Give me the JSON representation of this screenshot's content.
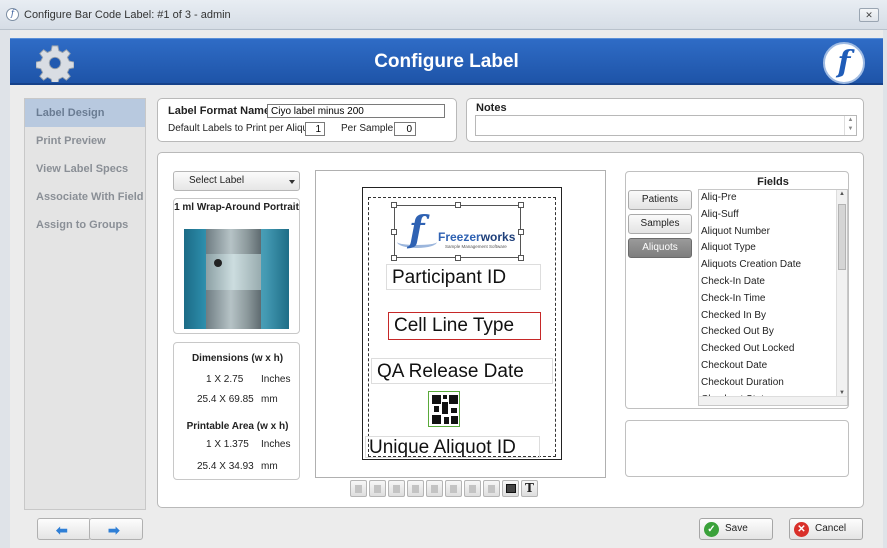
{
  "window": {
    "title": "Configure Bar Code Label: #1 of 3 - admin",
    "close_glyph": "✕"
  },
  "banner": {
    "title": "Configure Label",
    "logo_glyph": "f"
  },
  "sidebar": {
    "items": [
      {
        "label": "Label Design",
        "active": true
      },
      {
        "label": "Print Preview",
        "active": false
      },
      {
        "label": "View Label Specs",
        "active": false
      },
      {
        "label": "Associate With Field",
        "active": false
      },
      {
        "label": "Assign to Groups",
        "active": false
      }
    ]
  },
  "format": {
    "name_label": "Label Format Name:",
    "name_value": "Ciyo label minus 200",
    "default_labels_label": "Default Labels to Print per Aliquot:",
    "default_labels_value": "1",
    "per_sample_label": "Per Sample:",
    "per_sample_value": "0"
  },
  "notes": {
    "label": "Notes",
    "value": ""
  },
  "designer": {
    "select_label_button": "Select Label",
    "label_type": "1 ml Wrap-Around Portrait",
    "dimensions_title": "Dimensions (w x h)",
    "dimensions_in": "1 X 2.75",
    "dimensions_in_unit": "Inches",
    "dimensions_mm": "25.4 X 69.85",
    "dimensions_mm_unit": "mm",
    "printable_title": "Printable Area (w x h)",
    "printable_in": "1 X 1.375",
    "printable_in_unit": "Inches",
    "printable_mm": "25.4 X 34.93",
    "printable_mm_unit": "mm"
  },
  "canvas": {
    "logo_word_1": "Freezer",
    "logo_word_2": "works",
    "logo_subtitle": "Sample Management Software",
    "logo_glyph": "f",
    "fields": {
      "participant": "Participant ID",
      "cellline": "Cell Line Type",
      "qa": "QA Release Date",
      "unique": "Unique Aliquot ID"
    }
  },
  "toolbar": {
    "tools": [
      "align-left-icon",
      "align-center-icon",
      "align-right-icon",
      "align-bottom-icon",
      "distribute-icon",
      "group-icon",
      "columns-icon",
      "rows-icon",
      "image-icon",
      "text-icon"
    ],
    "text_glyph": "T"
  },
  "fields": {
    "title": "Fields",
    "categories": [
      {
        "label": "Patients",
        "active": false
      },
      {
        "label": "Samples",
        "active": false
      },
      {
        "label": "Aliquots",
        "active": true
      }
    ],
    "items": [
      "Aliq-Pre",
      "Aliq-Suff",
      "Aliquot Number",
      "Aliquot Type",
      "Aliquots Creation Date",
      "Check-In Date",
      "Check-In Time",
      "Checked In By",
      "Checked Out By",
      "Checked Out Locked",
      "Checkout Date",
      "Checkout Duration",
      "Checkout Status"
    ]
  },
  "footer": {
    "save": "Save",
    "cancel": "Cancel",
    "back_glyph": "⬅",
    "forward_glyph": "➡"
  },
  "colors": {
    "banner": "#2059b0",
    "nav_active": "#b8c9df",
    "selected_field_border": "#c62828",
    "save_icon": "#3aa13a",
    "cancel_icon": "#d9302a"
  }
}
